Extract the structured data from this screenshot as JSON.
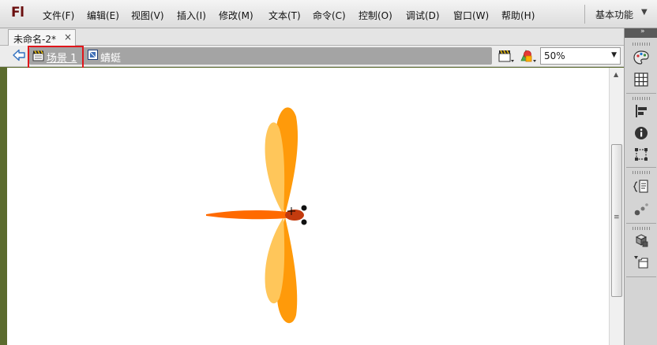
{
  "app": {
    "logo": "Fl"
  },
  "menu": [
    "文件(F)",
    "编辑(E)",
    "视图(V)",
    "插入(I)",
    "修改(M)",
    "文本(T)",
    "命令(C)",
    "控制(O)",
    "调试(D)",
    "窗口(W)",
    "帮助(H)"
  ],
  "workspace": {
    "label": "基本功能",
    "arrow": "▼"
  },
  "document_tab": {
    "title": "未命名-2*",
    "close": "×"
  },
  "edit_bar": {
    "scene_label": "场景 1",
    "symbol_label": "蜻蜓",
    "zoom": "50%",
    "zoom_arrow": "▼"
  },
  "scrollbar": {
    "up_arrow": "▲",
    "grip": "≡"
  },
  "panel": {
    "top_arrows": "»",
    "icons": [
      "color-icon",
      "swatches-icon",
      "align-icon",
      "info-icon",
      "transform-icon",
      "code-snippets-icon",
      "components-icon",
      "library-icon",
      "motion-presets-icon"
    ]
  },
  "colors": {
    "wing_dark": "#ff9a0a",
    "wing_light": "#ffc65a",
    "tail": "#ff6a00",
    "head": "#c33b0e",
    "highlight": "#e0161b"
  }
}
